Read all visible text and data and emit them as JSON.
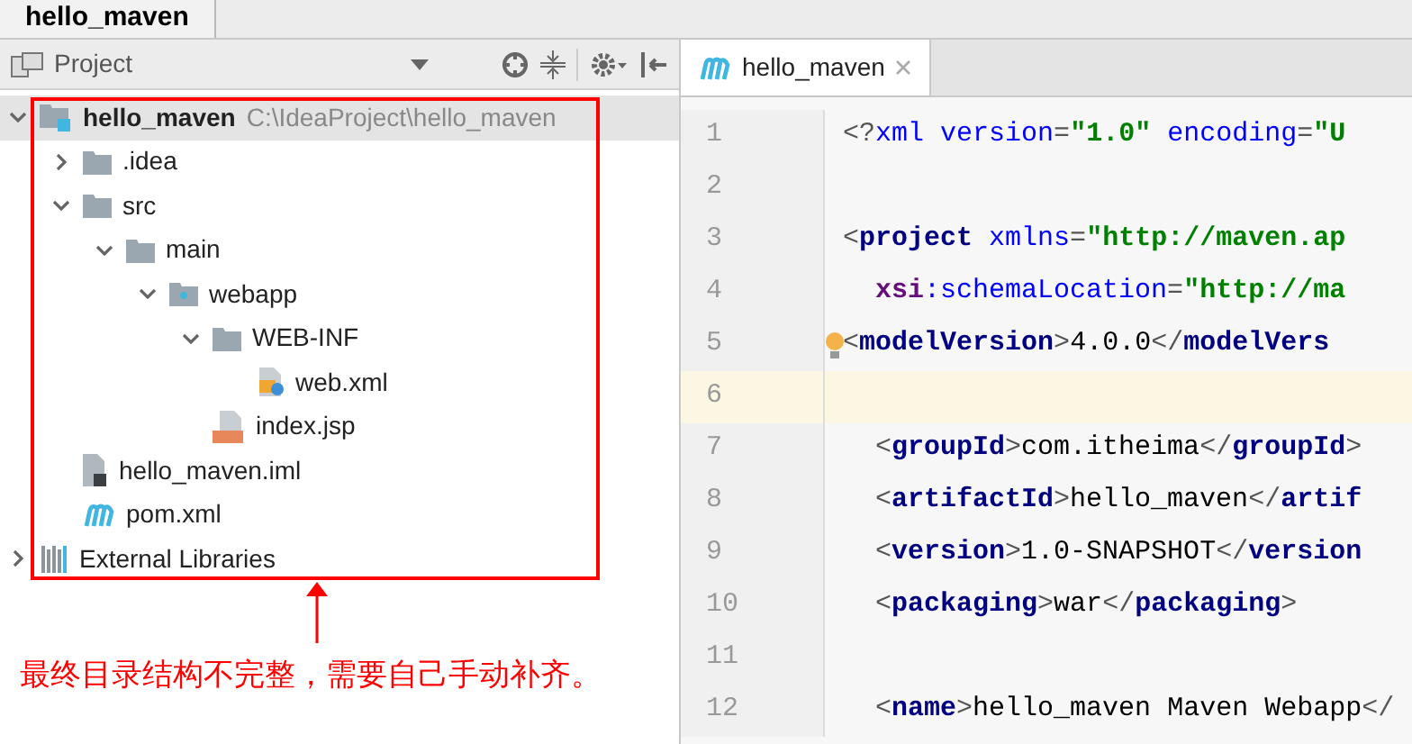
{
  "breadcrumb": {
    "label": "hello_maven"
  },
  "project_panel": {
    "title": "Project"
  },
  "tree": [
    {
      "label": "hello_maven",
      "path": "C:\\IdeaProject\\hello_maven",
      "kind": "module",
      "expanded": true,
      "children": [
        {
          "label": ".idea",
          "kind": "folder",
          "expanded": false
        },
        {
          "label": "src",
          "kind": "folder",
          "expanded": true,
          "children": [
            {
              "label": "main",
              "kind": "folder",
              "expanded": true,
              "children": [
                {
                  "label": "webapp",
                  "kind": "web",
                  "expanded": true,
                  "children": [
                    {
                      "label": "WEB-INF",
                      "kind": "folder",
                      "expanded": true,
                      "children": [
                        {
                          "label": "web.xml",
                          "kind": "xml"
                        }
                      ]
                    },
                    {
                      "label": "index.jsp",
                      "kind": "jsp"
                    }
                  ]
                }
              ]
            }
          ]
        },
        {
          "label": "hello_maven.iml",
          "kind": "iml"
        },
        {
          "label": "pom.xml",
          "kind": "maven"
        }
      ]
    },
    {
      "label": "External Libraries",
      "kind": "libraries",
      "expanded": false
    }
  ],
  "annotation": "最终目录结构不完整，需要自己手动补齐。",
  "editor_tab": {
    "label": "hello_maven",
    "selected": true
  },
  "code_lines": [
    {
      "number": "1",
      "tokens": [
        {
          "text": "<?",
          "kind": "punct"
        },
        {
          "text": "xml version",
          "kind": "attr"
        },
        {
          "text": "=",
          "kind": "punct"
        },
        {
          "text": "\"1.0\"",
          "kind": "value"
        },
        {
          "text": " encoding",
          "kind": "attr"
        },
        {
          "text": "=",
          "kind": "punct"
        },
        {
          "text": "\"U",
          "kind": "value"
        }
      ]
    },
    {
      "number": "2"
    },
    {
      "number": "3",
      "tokens": [
        {
          "text": "<",
          "kind": "punct"
        },
        {
          "text": "project",
          "kind": "tag"
        },
        {
          "text": " xmlns",
          "kind": "attr"
        },
        {
          "text": "=",
          "kind": "punct"
        },
        {
          "text": "\"http://maven.ap",
          "kind": "value"
        }
      ]
    },
    {
      "number": "4",
      "tokens": [
        {
          "text": "  xsi",
          "kind": "ns"
        },
        {
          "text": ":schemaLocation",
          "kind": "attr"
        },
        {
          "text": "=",
          "kind": "punct"
        },
        {
          "text": "\"http://ma",
          "kind": "value"
        }
      ]
    },
    {
      "number": "5",
      "bulb": true,
      "tokens": [
        {
          "text": "<",
          "kind": "punct"
        },
        {
          "text": "modelVersion",
          "kind": "tag"
        },
        {
          "text": ">",
          "kind": "punct"
        },
        {
          "text": "4.0.0",
          "kind": "content"
        },
        {
          "text": "</",
          "kind": "punct"
        },
        {
          "text": "modelVers",
          "kind": "tag"
        }
      ]
    },
    {
      "number": "6",
      "current": true
    },
    {
      "number": "7",
      "tokens": [
        {
          "text": "  <",
          "kind": "punct"
        },
        {
          "text": "groupId",
          "kind": "tag"
        },
        {
          "text": ">",
          "kind": "punct"
        },
        {
          "text": "com.itheima",
          "kind": "content"
        },
        {
          "text": "</",
          "kind": "punct"
        },
        {
          "text": "groupId",
          "kind": "tag"
        },
        {
          "text": ">",
          "kind": "punct"
        }
      ]
    },
    {
      "number": "8",
      "tokens": [
        {
          "text": "  <",
          "kind": "punct"
        },
        {
          "text": "artifactId",
          "kind": "tag"
        },
        {
          "text": ">",
          "kind": "punct"
        },
        {
          "text": "hello_maven",
          "kind": "content"
        },
        {
          "text": "</",
          "kind": "punct"
        },
        {
          "text": "artif",
          "kind": "tag"
        }
      ]
    },
    {
      "number": "9",
      "tokens": [
        {
          "text": "  <",
          "kind": "punct"
        },
        {
          "text": "version",
          "kind": "tag"
        },
        {
          "text": ">",
          "kind": "punct"
        },
        {
          "text": "1.0-SNAPSHOT",
          "kind": "content"
        },
        {
          "text": "</",
          "kind": "punct"
        },
        {
          "text": "version",
          "kind": "tag"
        }
      ]
    },
    {
      "number": "10",
      "tokens": [
        {
          "text": "  <",
          "kind": "punct"
        },
        {
          "text": "packaging",
          "kind": "tag"
        },
        {
          "text": ">",
          "kind": "punct"
        },
        {
          "text": "war",
          "kind": "content"
        },
        {
          "text": "</",
          "kind": "punct"
        },
        {
          "text": "packaging",
          "kind": "tag"
        },
        {
          "text": ">",
          "kind": "punct"
        }
      ]
    },
    {
      "number": "11"
    },
    {
      "number": "12",
      "tokens": [
        {
          "text": "  <",
          "kind": "punct"
        },
        {
          "text": "name",
          "kind": "tag"
        },
        {
          "text": ">",
          "kind": "punct"
        },
        {
          "text": "hello_maven Maven Webapp",
          "kind": "content"
        },
        {
          "text": "</",
          "kind": "punct"
        }
      ]
    }
  ]
}
